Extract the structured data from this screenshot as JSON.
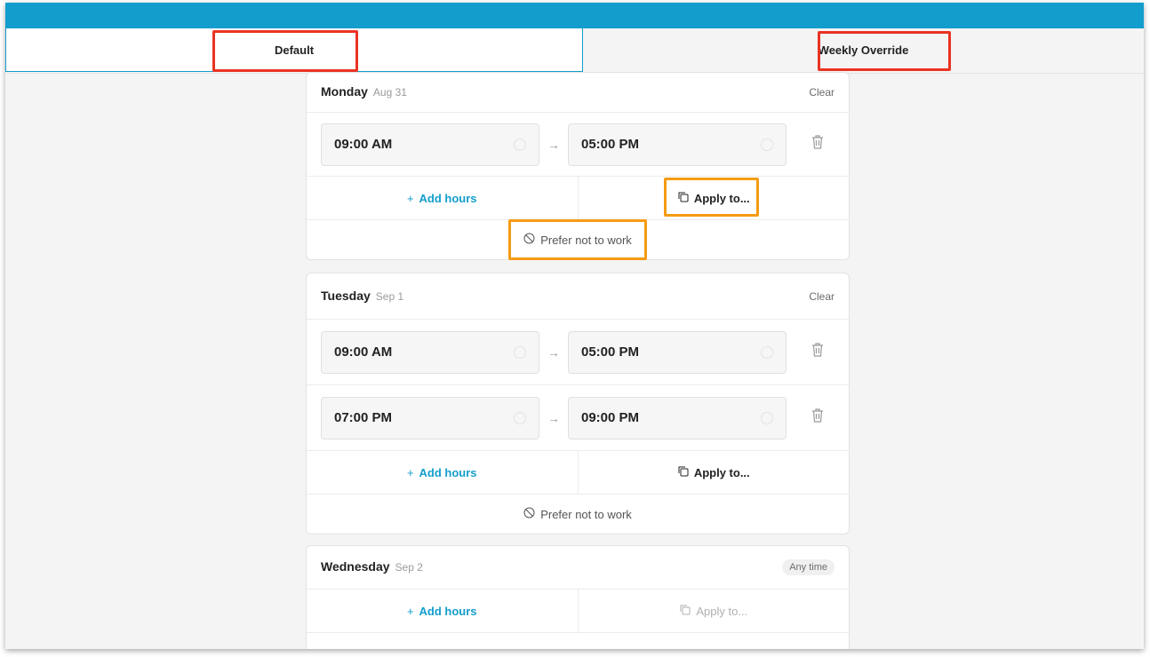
{
  "tabs": {
    "default": "Default",
    "weekly": "Weekly Override"
  },
  "colors": {
    "brand": "#129dcd",
    "highlight_red": "#ea3323",
    "highlight_orange": "#f59b12"
  },
  "icons": {
    "add": "plus-icon",
    "apply": "copy-icon",
    "prefer": "block-icon",
    "delete": "trash-icon",
    "clock": "clock-icon",
    "arrow": "arrow-right-icon"
  },
  "labels": {
    "clear": "Clear",
    "any_time": "Any time",
    "add_hours": "Add hours",
    "apply_to": "Apply to...",
    "prefer_not": "Prefer not to work",
    "plus": "+",
    "arrow": "→"
  },
  "days": [
    {
      "name": "Monday",
      "date": "Aug 31",
      "slots": [
        {
          "start": "09:00 AM",
          "end": "05:00 PM"
        }
      ]
    },
    {
      "name": "Tuesday",
      "date": "Sep 1",
      "slots": [
        {
          "start": "09:00 AM",
          "end": "05:00 PM"
        },
        {
          "start": "07:00 PM",
          "end": "09:00 PM"
        }
      ]
    },
    {
      "name": "Wednesday",
      "date": "Sep 2",
      "slots": []
    }
  ]
}
